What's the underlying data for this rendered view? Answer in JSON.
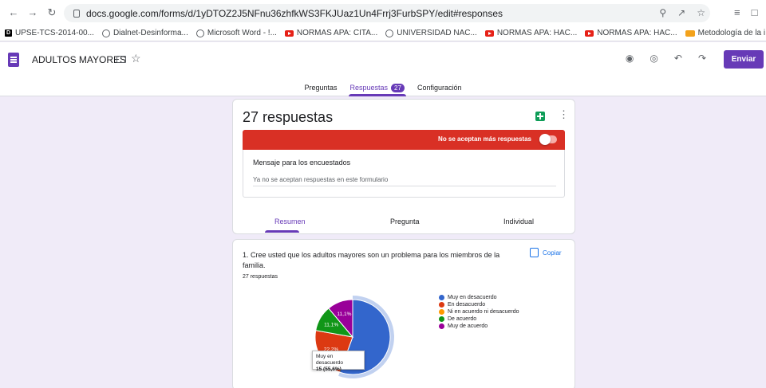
{
  "browser": {
    "url": "docs.google.com/forms/d/1yDTOZ2J5NFnu36zhfkWS3FKJUaz1Un4Frrj3FurbSPY/edit#responses",
    "bookmarks": [
      {
        "label": "UPSE-TCS-2014-00...",
        "icon": "d-icon"
      },
      {
        "label": "Dialnet-Desinforma...",
        "icon": "globe-icon"
      },
      {
        "label": "Microsoft Word - !...",
        "icon": "globe-icon"
      },
      {
        "label": "NORMAS APA: CITA...",
        "icon": "youtube-icon"
      },
      {
        "label": "UNIVERSIDAD NAC...",
        "icon": "globe-icon"
      },
      {
        "label": "NORMAS APA: HAC...",
        "icon": "youtube-icon"
      },
      {
        "label": "NORMAS APA: HAC...",
        "icon": "youtube-icon"
      },
      {
        "label": "Metodología de la i...",
        "icon": "uq-icon"
      }
    ]
  },
  "header": {
    "form_title": "ADULTOS MAYORES",
    "send_label": "Enviar",
    "tabs": {
      "questions": "Preguntas",
      "responses": "Respuestas",
      "responses_badge": "27",
      "settings": "Configuración"
    }
  },
  "summary": {
    "count_label": "27 respuestas",
    "not_accepting_label": "No se aceptan más respuestas",
    "message_title": "Mensaje para los encuestados",
    "message_text": "Ya no se aceptan respuestas en este formulario",
    "subtabs": {
      "summary": "Resumen",
      "question": "Pregunta",
      "individual": "Individual"
    }
  },
  "question": {
    "text": "1. Cree usted que los adultos mayores son un problema para los miembros de la familia.",
    "responses": "27 respuestas",
    "copy_label": "Copiar",
    "tooltip_title": "Muy en desacuerdo",
    "tooltip_value": "15 (55,6%)"
  },
  "chart_data": {
    "type": "pie",
    "categories": [
      "Muy en desacuerdo",
      "En desacuerdo",
      "Ni en acuerdo ni desacuerdo",
      "De acuerdo",
      "Muy de acuerdo"
    ],
    "values": [
      55.6,
      22.2,
      0,
      11.1,
      11.1
    ],
    "labels": [
      "",
      "22,2%",
      "",
      "11,1%",
      "11,1%"
    ],
    "colors": [
      "#3366cc",
      "#dc3912",
      "#ff9900",
      "#109618",
      "#990099"
    ],
    "legend_position": "right"
  }
}
